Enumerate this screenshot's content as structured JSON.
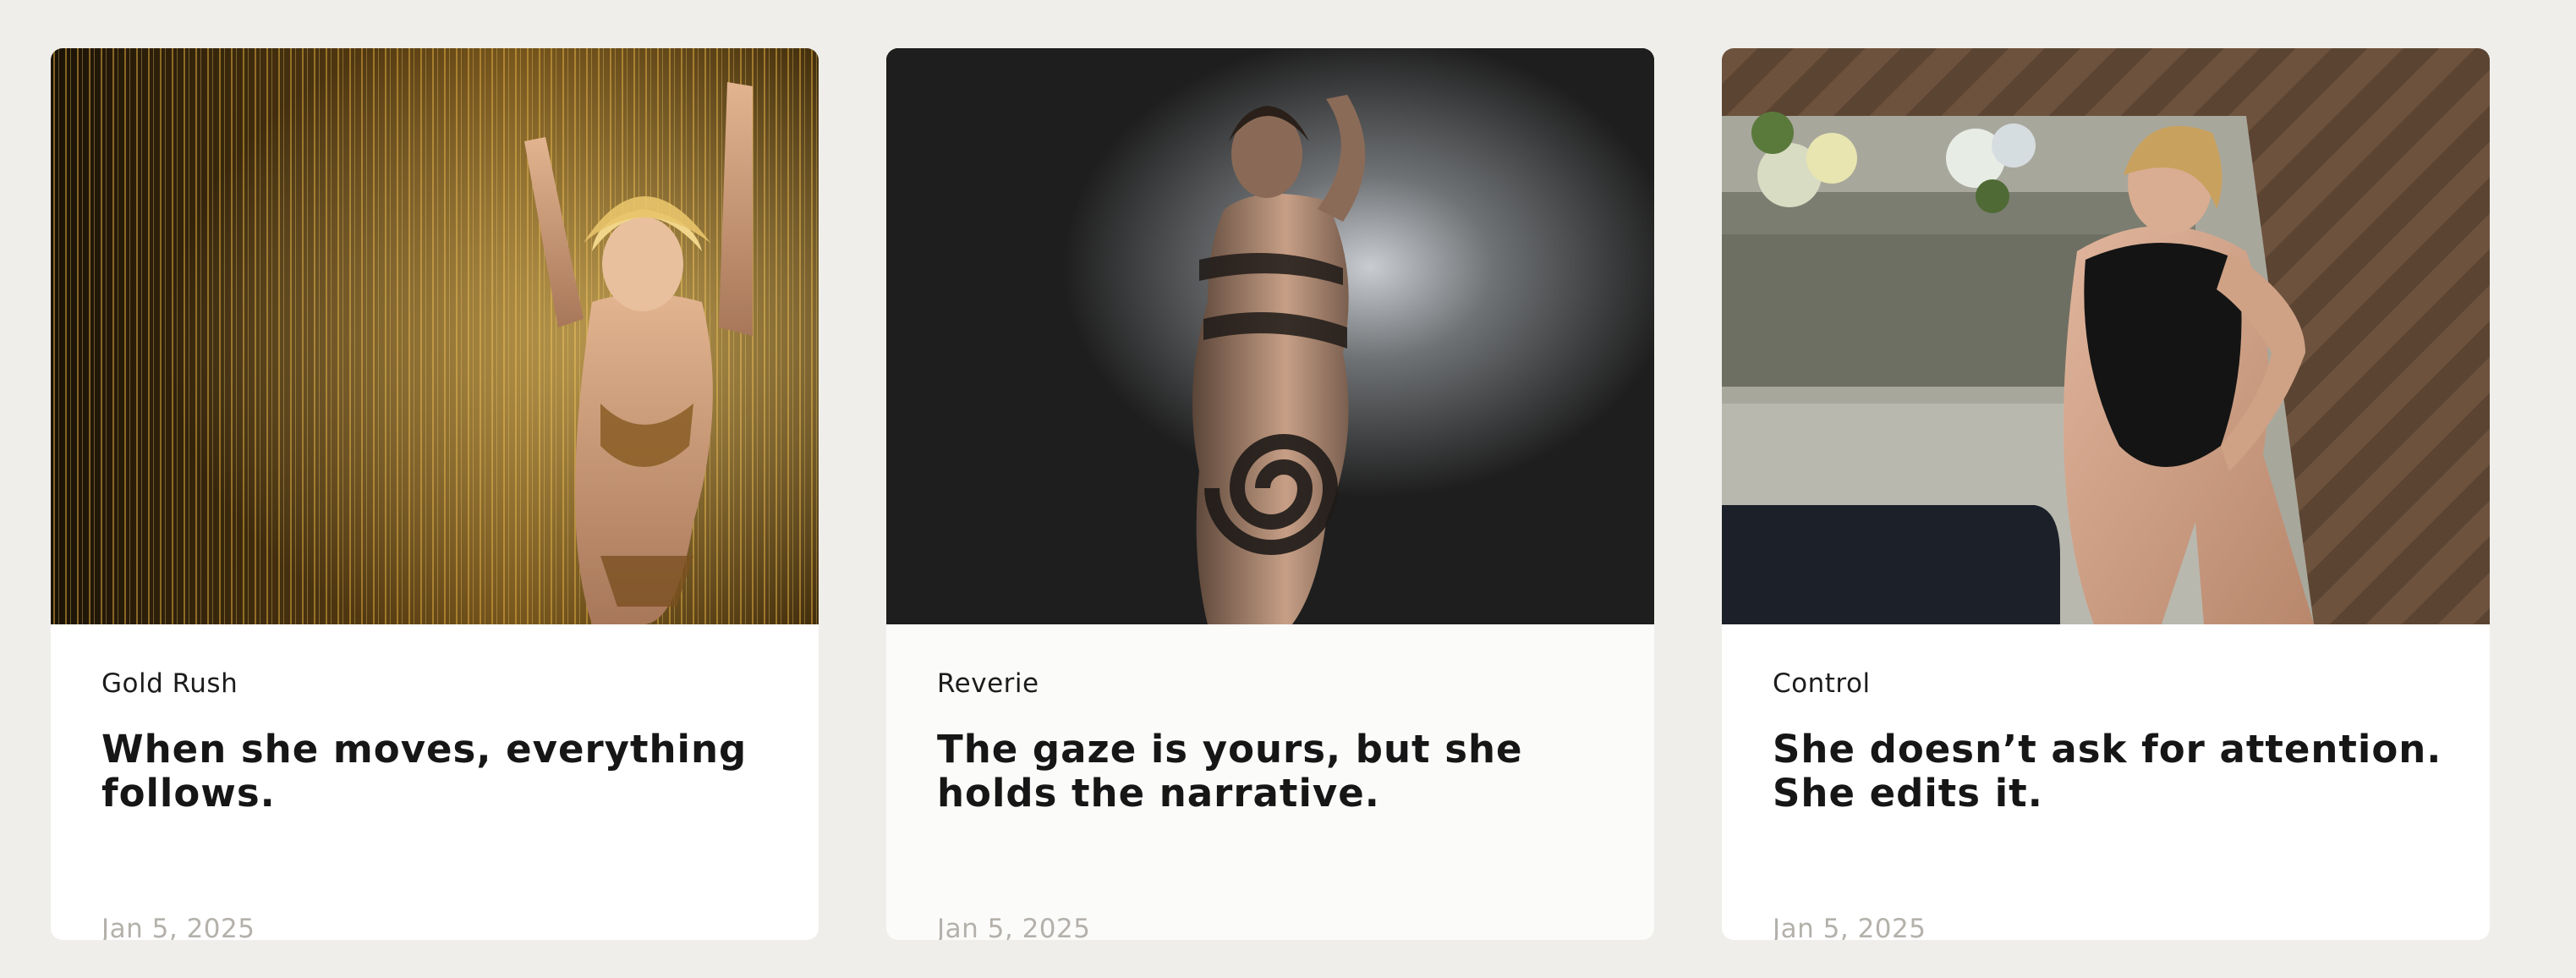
{
  "posts": [
    {
      "category": "Gold Rush",
      "headline": "When she moves, everything follows.",
      "date": "Jan 5, 2025",
      "image_icon": "photo-gold-curtain"
    },
    {
      "category": "Reverie",
      "headline": "The gaze is yours, but she holds the narrative.",
      "date": "Jan 5, 2025",
      "image_icon": "photo-shadow-spiral"
    },
    {
      "category": "Control",
      "headline": "She doesn’t ask for attention. She edits it.",
      "date": "Jan 5, 2025",
      "image_icon": "photo-black-bodysuit"
    }
  ],
  "colors": {
    "page_background": "#efeeea",
    "card_background": "#ffffff",
    "headline_text": "#161616",
    "date_text": "#b4b1ab"
  }
}
